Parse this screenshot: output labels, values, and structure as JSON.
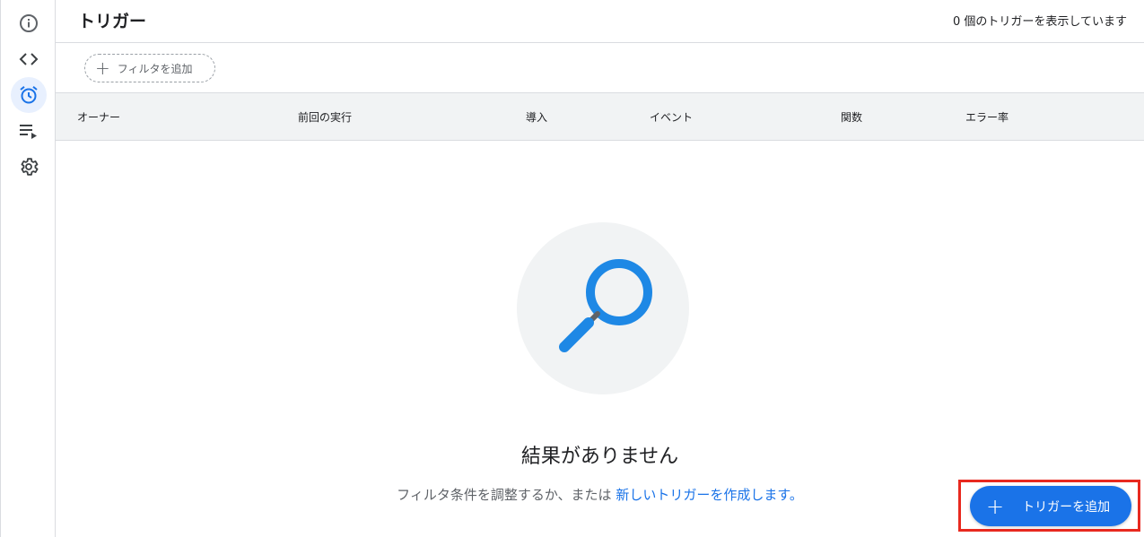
{
  "sidebar": {
    "items": [
      {
        "icon": "info-icon",
        "label": "概要"
      },
      {
        "icon": "code-icon",
        "label": "エディタ"
      },
      {
        "icon": "alarm-clock-icon",
        "label": "トリガー",
        "active": true
      },
      {
        "icon": "executions-icon",
        "label": "実行数"
      },
      {
        "icon": "gear-icon",
        "label": "プロジェクトの設定"
      }
    ]
  },
  "header": {
    "title": "トリガー",
    "count_text": "0 個のトリガーを表示しています"
  },
  "filter": {
    "add_label": "フィルタを追加"
  },
  "table": {
    "columns": [
      "オーナー",
      "前回の実行",
      "導入",
      "イベント",
      "関数",
      "エラー率"
    ]
  },
  "empty": {
    "icon": "search-icon",
    "title": "結果がありません",
    "subtitle": "フィルタ条件を調整するか、または",
    "link": "新しいトリガーを作成します。"
  },
  "fab": {
    "label": "トリガーを追加"
  },
  "colors": {
    "accent": "#1a73e8",
    "search_icon": "#1e88e5",
    "highlight": "#e8291f"
  }
}
